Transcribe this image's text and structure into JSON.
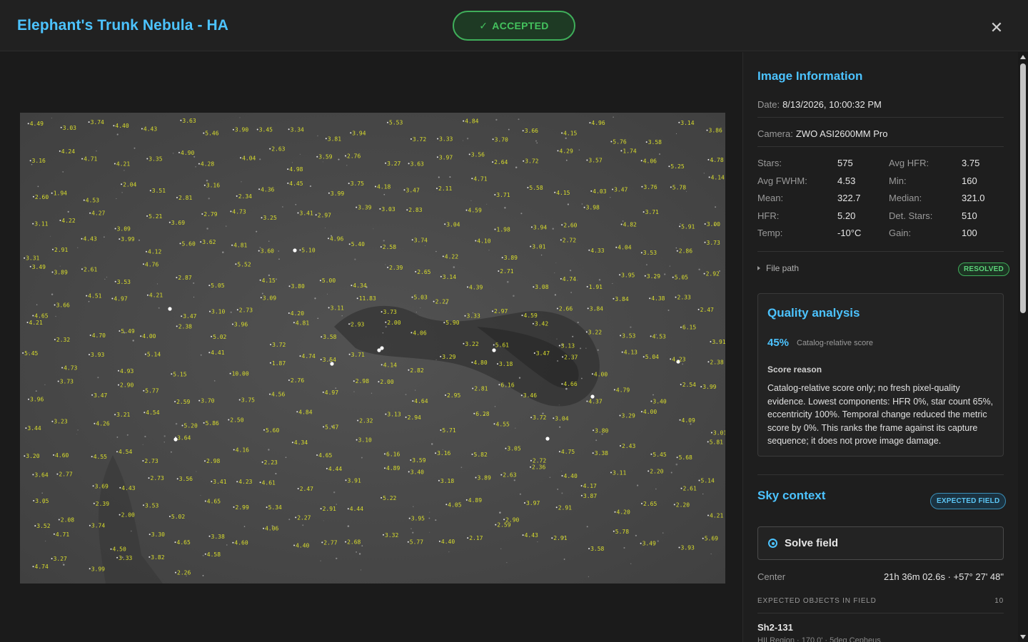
{
  "window": {
    "title": "Elephant's Trunk Nebula - HA",
    "status": "ACCEPTED",
    "status_icon": "check-icon",
    "close_icon": "close-icon"
  },
  "info": {
    "title": "Image Information",
    "date_label": "Date:",
    "date_value": "8/13/2026, 10:00:32 PM",
    "camera_label": "Camera:",
    "camera_value": "ZWO ASI2600MM Pro",
    "stats": [
      {
        "l1": "Stars:",
        "v1": "575",
        "l2": "Avg HFR:",
        "v2": "3.75"
      },
      {
        "l1": "Avg FWHM:",
        "v1": "4.53",
        "l2": "Min:",
        "v2": "160"
      },
      {
        "l1": "Mean:",
        "v1": "322.7",
        "l2": "Median:",
        "v2": "321.0"
      },
      {
        "l1": "HFR:",
        "v1": "5.20",
        "l2": "Det. Stars:",
        "v2": "510"
      },
      {
        "l1": "Temp:",
        "v1": "-10°C",
        "l2": "Gain:",
        "v2": "100"
      }
    ],
    "file_path_label": "File path",
    "file_path_badge": "RESOLVED"
  },
  "quality": {
    "title": "Quality analysis",
    "score": "45%",
    "score_label": "Catalog-relative score",
    "reason_label": "Score reason",
    "reason_text": "Catalog-relative score only; no fresh pixel-quality evidence. Lowest components: HFR 0%, star count 65%, eccentricity 100%. Temporal change reduced the metric score by 0%. This ranks the frame against its capture sequence; it does not prove image damage."
  },
  "sky": {
    "title": "Sky context",
    "badge": "EXPECTED FIELD",
    "solve_label": "Solve field",
    "center_label": "Center",
    "center_value": "21h 36m 02.6s · +57° 27' 48\"",
    "expected_label": "EXPECTED OBJECTS IN FIELD",
    "expected_count": "10",
    "objects": [
      {
        "name": "Sh2-131",
        "sub": "HII Region · 170.0' · 5deg Cepheus"
      }
    ]
  },
  "star_labels": [
    "4.49",
    "3.03",
    "3.74",
    "4.40",
    "4.43",
    "3.63",
    "5.46",
    "3.90",
    "3.45",
    "3.34",
    "3.81",
    "3.94",
    "5.53",
    "3.72",
    "3.33",
    "4.84",
    "3.70",
    "3.66",
    "4.15",
    "4.96",
    "5.76",
    "3.58",
    "3.14",
    "3.86",
    "3.16",
    "4.24",
    "4.71",
    "4.21",
    "3.35",
    "4.90",
    "4.28",
    "4.04",
    "2.63",
    "4.98",
    "3.59",
    "2.76",
    "3.27",
    "3.63",
    "3.97",
    "3.56",
    "2.64",
    "3.72",
    "4.29",
    "3.57",
    "1.74",
    "4.06",
    "5.25",
    "4.78",
    "2.60",
    "1.94",
    "4.53",
    "2.04",
    "3.51",
    "2.81",
    "3.16",
    "2.34",
    "4.36",
    "4.45",
    "3.99",
    "3.75",
    "4.18",
    "3.47",
    "2.11",
    "4.71",
    "3.71",
    "5.58",
    "4.15",
    "4.03",
    "3.47",
    "3.76",
    "5.78",
    "4.14",
    "3.11",
    "4.22",
    "4.27",
    "3.09",
    "5.21",
    "3.69",
    "2.79",
    "4.73",
    "3.25",
    "3.41",
    "2.97",
    "3.39",
    "3.03",
    "2.83",
    "3.04",
    "4.59",
    "1.98",
    "3.94",
    "2.60",
    "3.98",
    "4.82",
    "3.71",
    "5.91",
    "3.00",
    "3.31",
    "2.91",
    "4.43",
    "3.99",
    "4.12",
    "5.60",
    "3.62",
    "4.81",
    "3.60",
    "5.10",
    "4.96",
    "5.40",
    "2.58",
    "3.74",
    "4.22",
    "4.10",
    "3.89",
    "3.01",
    "2.72",
    "4.33",
    "4.04",
    "3.53",
    "2.86",
    "3.73",
    "3.49",
    "3.89",
    "2.61",
    "3.53",
    "4.76",
    "2.87",
    "5.05",
    "5.52",
    "4.15",
    "3.80",
    "5.00",
    "4.34",
    "2.39",
    "2.65",
    "3.14",
    "4.39",
    "2.71",
    "3.08",
    "4.74",
    "1.91",
    "3.95",
    "3.29",
    "5.05",
    "2.92",
    "4.65",
    "3.66",
    "4.51",
    "4.97",
    "4.21",
    "3.47",
    "3.10",
    "2.73",
    "3.09",
    "4.20",
    "3.11",
    "11.83",
    "3.73",
    "5.03",
    "2.27",
    "3.33",
    "2.97",
    "4.59",
    "2.66",
    "3.84",
    "3.84",
    "4.38",
    "2.33",
    "2.47",
    "4.21",
    "2.32",
    "4.70",
    "5.49",
    "4.00",
    "2.38",
    "5.02",
    "3.96",
    "3.72",
    "4.81",
    "3.58",
    "2.93",
    "2.00",
    "4.06",
    "5.90",
    "3.22",
    "5.61",
    "3.42",
    "3.13",
    "3.22",
    "3.53",
    "4.53",
    "6.15",
    "3.91",
    "5.45",
    "4.73",
    "3.93",
    "4.93",
    "5.14",
    "5.15",
    "4.41",
    "10.00",
    "1.87",
    "4.74",
    "3.54",
    "3.71",
    "4.14",
    "2.82",
    "3.29",
    "4.80",
    "3.18",
    "3.47",
    "2.37",
    "4.00",
    "4.13",
    "5.04",
    "4.23",
    "2.38",
    "3.96",
    "3.73",
    "3.47",
    "2.90",
    "5.77",
    "2.59",
    "3.70",
    "3.75",
    "4.56",
    "2.76",
    "4.97",
    "2.98",
    "2.00",
    "4.64",
    "2.95",
    "2.81",
    "6.16",
    "3.46",
    "4.66",
    "4.37",
    "4.79",
    "3.40",
    "2.54",
    "3.99",
    "3.44",
    "3.23",
    "4.26",
    "3.21",
    "4.54",
    "5.20",
    "5.86",
    "2.50",
    "5.60",
    "4.84",
    "5.47",
    "2.32",
    "3.13",
    "2.94",
    "5.71",
    "6.28",
    "4.55",
    "3.72",
    "3.04",
    "3.80",
    "3.29",
    "4.00",
    "4.09",
    "3.01",
    "3.20",
    "4.60",
    "4.55",
    "4.54",
    "2.73",
    "3.64",
    "2.98",
    "4.16",
    "2.23",
    "4.34",
    "4.65",
    "3.10",
    "6.16",
    "3.59",
    "3.16",
    "5.82",
    "3.05",
    "2.72",
    "4.75",
    "3.38",
    "2.43",
    "5.45",
    "5.68",
    "5.81",
    "3.64",
    "2.77",
    "3.69",
    "4.43",
    "2.73",
    "3.56",
    "3.41",
    "4.23",
    "4.61",
    "2.47",
    "4.44",
    "3.91",
    "4.89",
    "3.40",
    "3.18",
    "3.89",
    "2.63",
    "2.36",
    "4.40",
    "4.17",
    "3.11",
    "2.20",
    "2.61",
    "5.14",
    "3.05",
    "2.08",
    "2.39",
    "2.00",
    "3.53",
    "5.02",
    "4.65",
    "2.99",
    "5.34",
    "2.27",
    "2.91",
    "4.44",
    "5.22",
    "3.95",
    "4.05",
    "4.89",
    "2.90",
    "3.97",
    "2.91",
    "3.87",
    "4.20",
    "2.65",
    "2.20",
    "4.21",
    "3.52",
    "4.71",
    "3.74",
    "4.50",
    "3.30",
    "4.65",
    "3.38",
    "4.60",
    "4.06",
    "4.40",
    "2.77",
    "2.68",
    "3.32",
    "5.77",
    "4.40",
    "2.17",
    "2.59",
    "4.43",
    "2.91",
    "3.58",
    "5.78",
    "3.49",
    "3.93",
    "5.69",
    "4.74",
    "3.27",
    "3.99",
    "3.33",
    "3.82",
    "2.26",
    "4.58"
  ]
}
